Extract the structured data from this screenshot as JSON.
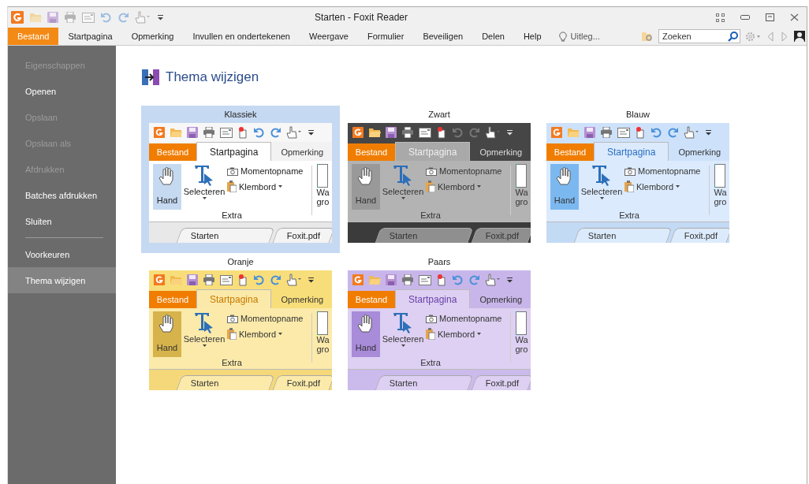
{
  "window": {
    "title": "Starten - Foxit Reader"
  },
  "menu": {
    "tabs": [
      {
        "label": "Bestand",
        "selected": true
      },
      {
        "label": "Startpagina",
        "selected": false
      },
      {
        "label": "Opmerking",
        "selected": false
      },
      {
        "label": "Invullen en ondertekenen",
        "selected": false
      },
      {
        "label": "Weergave",
        "selected": false
      },
      {
        "label": "Formulier",
        "selected": false
      },
      {
        "label": "Beveiligen",
        "selected": false
      },
      {
        "label": "Delen",
        "selected": false
      },
      {
        "label": "Help",
        "selected": false
      }
    ],
    "tell_me": "Uitleg...",
    "search": {
      "placeholder": "Zoeken"
    }
  },
  "sidebar": {
    "items": [
      {
        "kind": "item",
        "label": "Eigenschappen",
        "disabled": true,
        "selected": false
      },
      {
        "kind": "item",
        "label": "Openen",
        "disabled": false,
        "selected": false
      },
      {
        "kind": "item",
        "label": "Opslaan",
        "disabled": true,
        "selected": false
      },
      {
        "kind": "item",
        "label": "Opslaan als",
        "disabled": true,
        "selected": false
      },
      {
        "kind": "item",
        "label": "Afdrukken",
        "disabled": true,
        "selected": false
      },
      {
        "kind": "item",
        "label": "Batches afdrukken",
        "disabled": false,
        "selected": false
      },
      {
        "kind": "item",
        "label": "Sluiten",
        "disabled": false,
        "selected": false
      },
      {
        "kind": "separator"
      },
      {
        "kind": "item",
        "label": "Voorkeuren",
        "disabled": false,
        "selected": false
      },
      {
        "kind": "item",
        "label": "Thema wijzigen",
        "disabled": false,
        "selected": true
      }
    ]
  },
  "page": {
    "title": "Thema wijzigen",
    "themes": [
      {
        "name": "Klassiek",
        "kind": "classic",
        "selected": true,
        "tabs": [
          "Bestand",
          "Startpagina",
          "Opmerking"
        ],
        "hand": "Hand",
        "select": "Selecteren",
        "snapshot": "Momentopname",
        "clipboard": "Klembord",
        "group": "Extra",
        "cut_top": "Wa",
        "cut_bottom": "gro",
        "doc_tabs": [
          "Starten",
          "Foxit.pdf"
        ]
      },
      {
        "name": "Zwart",
        "kind": "black",
        "selected": false,
        "tabs": [
          "Bestand",
          "Startpagina",
          "Opmerking"
        ],
        "hand": "Hand",
        "select": "Selecteren",
        "snapshot": "Momentopname",
        "clipboard": "Klembord",
        "group": "Extra",
        "cut_top": "Wa",
        "cut_bottom": "gro",
        "doc_tabs": [
          "Starten",
          "Foxit.pdf"
        ]
      },
      {
        "name": "Blauw",
        "kind": "blue",
        "selected": false,
        "tabs": [
          "Bestand",
          "Startpagina",
          "Opmerking"
        ],
        "hand": "Hand",
        "select": "Selecteren",
        "snapshot": "Momentopname",
        "clipboard": "Klembord",
        "group": "Extra",
        "cut_top": "Wa",
        "cut_bottom": "gro",
        "doc_tabs": [
          "Starten",
          "Foxit.pdf"
        ]
      },
      {
        "name": "Oranje",
        "kind": "orange",
        "selected": false,
        "tabs": [
          "Bestand",
          "Startpagina",
          "Opmerking"
        ],
        "hand": "Hand",
        "select": "Selecteren",
        "snapshot": "Momentopname",
        "clipboard": "Klembord",
        "group": "Extra",
        "cut_top": "Wa",
        "cut_bottom": "gro",
        "doc_tabs": [
          "Starten",
          "Foxit.pdf"
        ]
      },
      {
        "name": "Paars",
        "kind": "purple",
        "selected": false,
        "tabs": [
          "Bestand",
          "Startpagina",
          "Opmerking"
        ],
        "hand": "Hand",
        "select": "Selecteren",
        "snapshot": "Momentopname",
        "clipboard": "Klembord",
        "group": "Extra",
        "cut_top": "Wa",
        "cut_bottom": "gro",
        "doc_tabs": [
          "Starten",
          "Foxit.pdf"
        ]
      }
    ]
  }
}
